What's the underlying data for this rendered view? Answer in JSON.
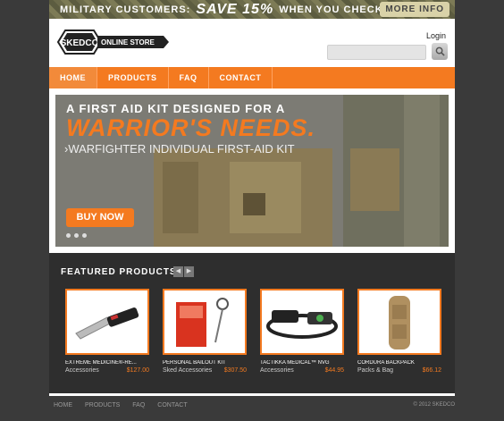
{
  "promo": {
    "text1": "MILITARY CUSTOMERS:",
    "text2": "SAVE 15%",
    "text3": "WHEN YOU CHECK OUT.",
    "more_label": "MORE INFO"
  },
  "header": {
    "logo_text": "SKEDCO",
    "logo_subtext": "ONLINE STORE",
    "login_label": "Login",
    "search_placeholder": ""
  },
  "nav": {
    "items": [
      {
        "label": "HOME"
      },
      {
        "label": "PRODUCTS"
      },
      {
        "label": "FAQ"
      },
      {
        "label": "CONTACT"
      }
    ]
  },
  "hero": {
    "line1": "A FIRST AID KIT DESIGNED FOR A",
    "line2": "WARRIOR'S NEEDS.",
    "line3": "›WARFIGHTER INDIVIDUAL FIRST-AID KIT",
    "cta_label": "BUY NOW"
  },
  "featured": {
    "title": "FEATURED PRODUCTS",
    "products": [
      {
        "name": "EXTREME MEDICINE®-RE...",
        "category": "Accessories",
        "price": "$127.00"
      },
      {
        "name": "PERSONAL BAILOUT KIT",
        "category": "Sked Accessories",
        "price": "$307.50"
      },
      {
        "name": "TACTIKKA MEDICAL™ NVG",
        "category": "Accessories",
        "price": "$44.95"
      },
      {
        "name": "CORDURA BACKPACK",
        "category": "Packs & Bag",
        "price": "$66.12"
      }
    ]
  },
  "footer": {
    "links": [
      "HOME",
      "PRODUCTS",
      "FAQ",
      "CONTACT"
    ],
    "copyright": "© 2012 SKEDCO"
  },
  "colors": {
    "accent": "#f47a20",
    "background": "#3a3a3a",
    "featured_bg": "#2e2e2e"
  }
}
